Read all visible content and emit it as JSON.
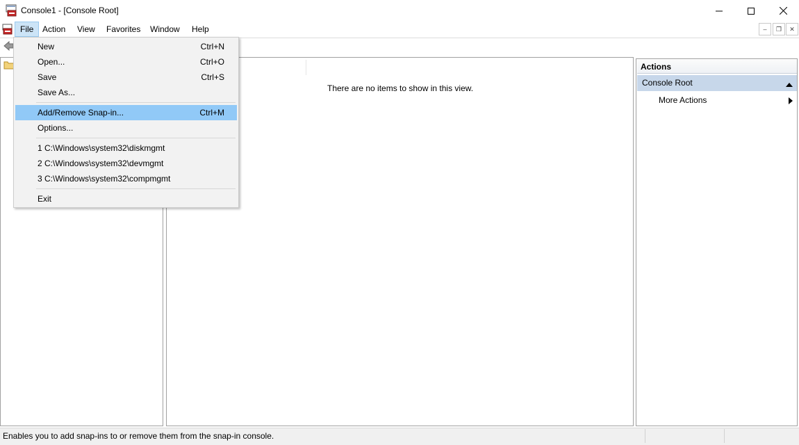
{
  "window": {
    "title": "Console1 - [Console Root]"
  },
  "menubar": {
    "items": [
      "File",
      "Action",
      "View",
      "Favorites",
      "Window",
      "Help"
    ]
  },
  "file_menu": {
    "items": [
      {
        "label": "New",
        "shortcut": "Ctrl+N"
      },
      {
        "label": "Open...",
        "shortcut": "Ctrl+O"
      },
      {
        "label": "Save",
        "shortcut": "Ctrl+S"
      },
      {
        "label": "Save As...",
        "shortcut": ""
      },
      {
        "label": "Add/Remove Snap-in...",
        "shortcut": "Ctrl+M",
        "highlighted": true
      },
      {
        "label": "Options...",
        "shortcut": ""
      },
      {
        "label": "1 C:\\Windows\\system32\\diskmgmt",
        "shortcut": ""
      },
      {
        "label": "2 C:\\Windows\\system32\\devmgmt",
        "shortcut": ""
      },
      {
        "label": "3 C:\\Windows\\system32\\compmgmt",
        "shortcut": ""
      },
      {
        "label": "Exit",
        "shortcut": ""
      }
    ]
  },
  "result_pane": {
    "empty_message": "There are no items to show in this view."
  },
  "actions_pane": {
    "header": "Actions",
    "section": "Console Root",
    "more_actions": "More Actions"
  },
  "statusbar": {
    "text": "Enables you to add snap-ins to or remove them from the snap-in console."
  },
  "colors": {
    "menu_highlight": "#91c9f7",
    "active_menu": "#cce4f7",
    "actions_section": "#c7d7ea"
  },
  "icons": [
    "app-icon",
    "minimize-icon",
    "maximize-icon",
    "close-icon",
    "back-arrow-icon",
    "folder-icon",
    "collapse-arrow-icon",
    "expand-arrow-icon"
  ]
}
